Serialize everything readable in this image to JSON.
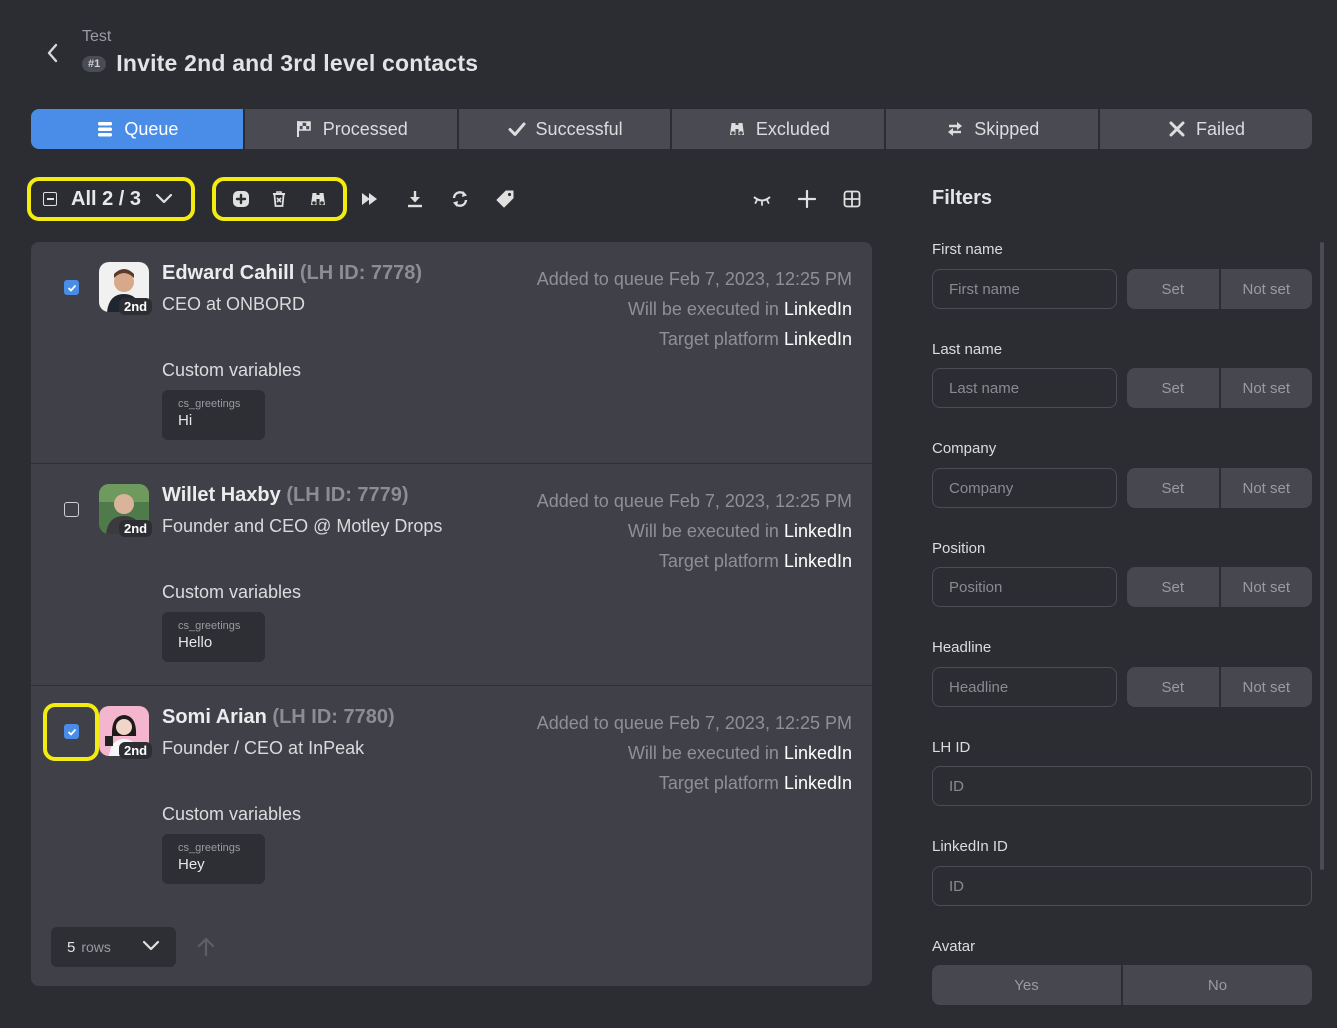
{
  "header": {
    "breadcrumb": "Test",
    "number_badge": "#1",
    "title": "Invite 2nd and 3rd level contacts"
  },
  "tabs": [
    {
      "label": "Queue",
      "icon": "stack-icon",
      "active": true
    },
    {
      "label": "Processed",
      "icon": "flag-icon",
      "active": false
    },
    {
      "label": "Successful",
      "icon": "check-icon",
      "active": false
    },
    {
      "label": "Excluded",
      "icon": "binoculars-icon",
      "active": false
    },
    {
      "label": "Skipped",
      "icon": "arrows-swap-icon",
      "active": false
    },
    {
      "label": "Failed",
      "icon": "x-icon",
      "active": false
    }
  ],
  "toolbar": {
    "selection_label": "All 2 / 3",
    "icons": [
      "add-circle-icon",
      "trash-icon",
      "binoculars-icon",
      "fast-forward-icon",
      "download-icon",
      "refresh-icon",
      "tag-icon",
      "eye-closed-icon",
      "plus-icon",
      "grid-icon"
    ]
  },
  "items": [
    {
      "name": "Edward Cahill",
      "lh_id": "(LH ID: 7778)",
      "degree": "2nd",
      "position": "CEO at ONBORD",
      "checked": true,
      "added_text": "Added to queue Feb 7, 2023, 12:25 PM",
      "executed_prefix": "Will be executed in",
      "executed_link": "LinkedIn",
      "target_prefix": "Target platform",
      "target_link": "LinkedIn",
      "cv_label": "Custom variables",
      "cv_key": "cs_greetings",
      "cv_value": "Hi"
    },
    {
      "name": "Willet Haxby",
      "lh_id": "(LH ID: 7779)",
      "degree": "2nd",
      "position": "Founder and CEO @ Motley Drops",
      "checked": false,
      "added_text": "Added to queue Feb 7, 2023, 12:25 PM",
      "executed_prefix": "Will be executed in",
      "executed_link": "LinkedIn",
      "target_prefix": "Target platform",
      "target_link": "LinkedIn",
      "cv_label": "Custom variables",
      "cv_key": "cs_greetings",
      "cv_value": "Hello"
    },
    {
      "name": "Somi Arian",
      "lh_id": "(LH ID: 7780)",
      "degree": "2nd",
      "position": "Founder / CEO at InPeak",
      "checked": true,
      "added_text": "Added to queue Feb 7, 2023, 12:25 PM",
      "executed_prefix": "Will be executed in",
      "executed_link": "LinkedIn",
      "target_prefix": "Target platform",
      "target_link": "LinkedIn",
      "cv_label": "Custom variables",
      "cv_key": "cs_greetings",
      "cv_value": "Hey"
    }
  ],
  "pagination": {
    "rows_count": "5",
    "rows_word": "rows"
  },
  "filters": {
    "title": "Filters",
    "first_name": {
      "label": "First name",
      "placeholder": "First name"
    },
    "last_name": {
      "label": "Last name",
      "placeholder": "Last name"
    },
    "company": {
      "label": "Company",
      "placeholder": "Company"
    },
    "position": {
      "label": "Position",
      "placeholder": "Position"
    },
    "headline": {
      "label": "Headline",
      "placeholder": "Headline"
    },
    "lh_id": {
      "label": "LH ID",
      "placeholder": "ID"
    },
    "linkedin_id": {
      "label": "LinkedIn ID",
      "placeholder": "ID"
    },
    "avatar": {
      "label": "Avatar",
      "yes": "Yes",
      "no": "No"
    },
    "set_label": "Set",
    "not_set_label": "Not set"
  },
  "colors": {
    "accent": "#4a8de8",
    "highlight": "#f2ec11",
    "background": "#2c2d33"
  }
}
